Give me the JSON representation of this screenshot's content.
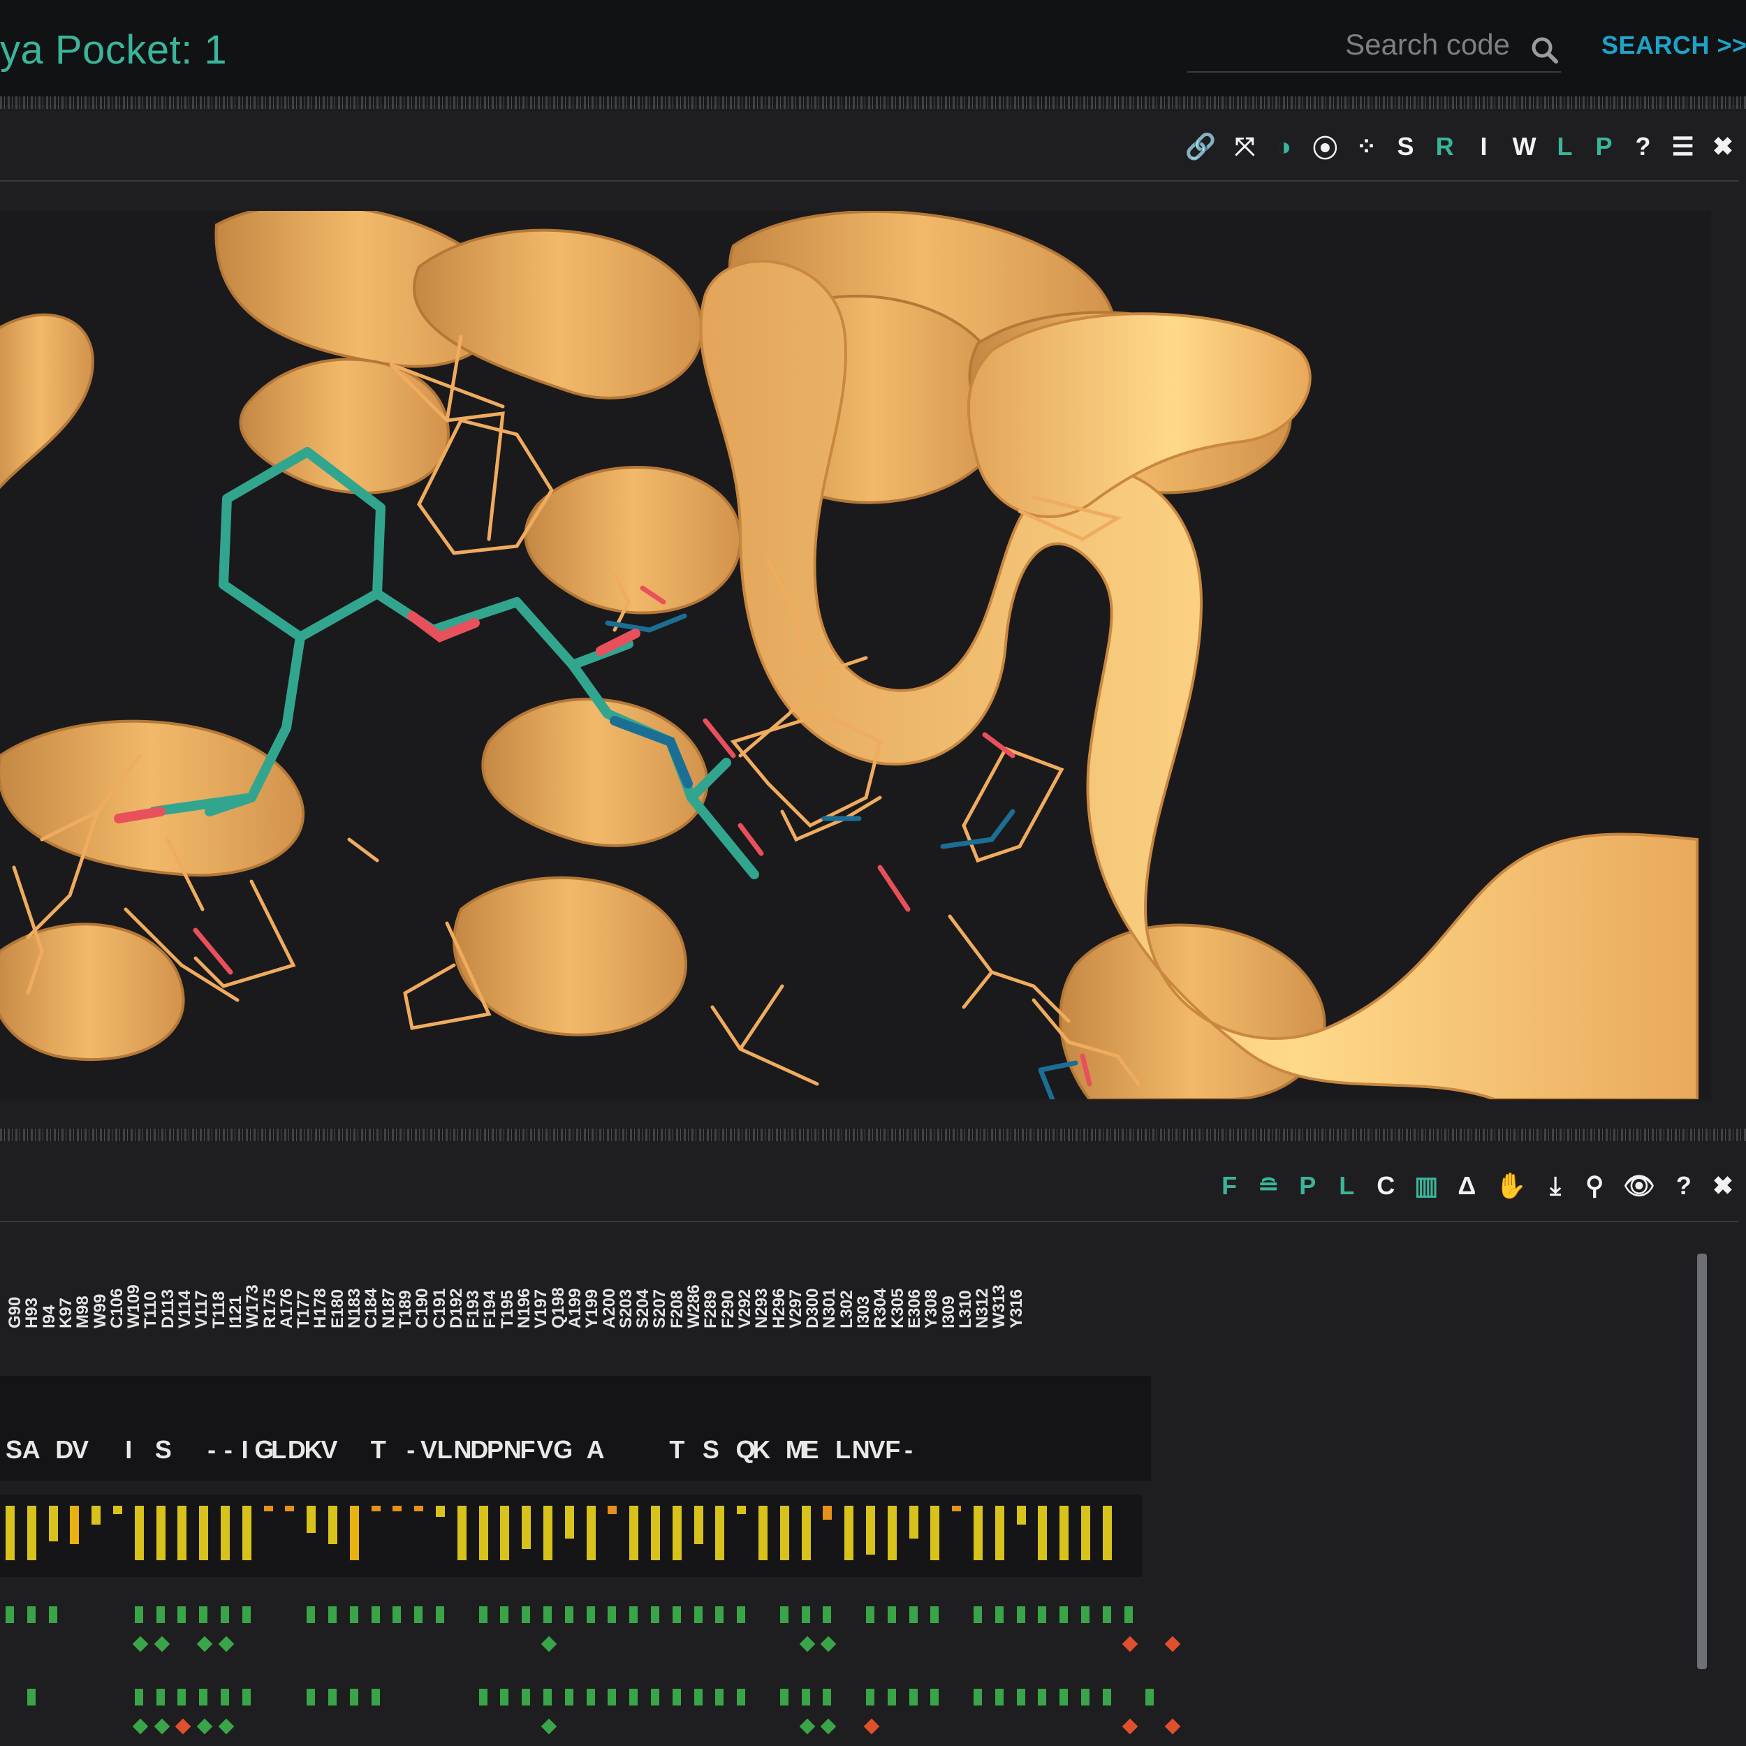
{
  "header": {
    "title": "ya Pocket: 1",
    "search_placeholder": "Search code",
    "search_link": "SEARCH >>"
  },
  "viewer_toolbar": [
    {
      "name": "link-icon",
      "glyph": "🔗",
      "color": "white"
    },
    {
      "name": "expand-icon",
      "glyph": "⤧",
      "color": "white"
    },
    {
      "name": "contrast-icon",
      "glyph": "◑",
      "color": "green"
    },
    {
      "name": "target-icon",
      "glyph": "⦿",
      "color": "white"
    },
    {
      "name": "spinner-icon",
      "glyph": "⁘",
      "color": "white"
    },
    {
      "name": "s-toggle",
      "glyph": "S",
      "color": "white"
    },
    {
      "name": "r-toggle",
      "glyph": "R",
      "color": "green"
    },
    {
      "name": "i-toggle",
      "glyph": "I",
      "color": "white"
    },
    {
      "name": "w-toggle",
      "glyph": "W",
      "color": "white"
    },
    {
      "name": "l-toggle",
      "glyph": "L",
      "color": "green"
    },
    {
      "name": "p-toggle",
      "glyph": "P",
      "color": "green"
    },
    {
      "name": "help-icon",
      "glyph": "?",
      "color": "white"
    },
    {
      "name": "menu-icon",
      "glyph": "☰",
      "color": "white"
    },
    {
      "name": "close-icon",
      "glyph": "✖",
      "color": "white"
    }
  ],
  "sequence_toolbar": [
    {
      "name": "f-toggle",
      "glyph": "F",
      "color": "green"
    },
    {
      "name": "stack-icon",
      "glyph": "≘",
      "color": "green"
    },
    {
      "name": "p-toggle",
      "glyph": "P",
      "color": "green"
    },
    {
      "name": "l-toggle",
      "glyph": "L",
      "color": "green"
    },
    {
      "name": "c-toggle",
      "glyph": "C",
      "color": "white"
    },
    {
      "name": "bar-chart-icon",
      "glyph": "▥",
      "color": "green"
    },
    {
      "name": "delta-icon",
      "glyph": "Δ",
      "color": "white"
    },
    {
      "name": "hand-icon",
      "glyph": "✋",
      "color": "white"
    },
    {
      "name": "download-icon",
      "glyph": "⤓",
      "color": "white"
    },
    {
      "name": "zoom-icon",
      "glyph": "⚲",
      "color": "white"
    },
    {
      "name": "eye-icon",
      "glyph": "👁",
      "color": "white"
    },
    {
      "name": "help-icon",
      "glyph": "?",
      "color": "white"
    },
    {
      "name": "close-icon",
      "glyph": "✖",
      "color": "white"
    }
  ],
  "residues": [
    "G90",
    "H93",
    "I94",
    "K97",
    "M98",
    "W99",
    "C106",
    "W109",
    "T110",
    "D113",
    "V114",
    "V117",
    "T118",
    "I121",
    "W173",
    "R175",
    "A176",
    "T177",
    "H178",
    "E180",
    "N183",
    "C184",
    "N187",
    "T189",
    "C190",
    "C191",
    "D192",
    "F193",
    "F194",
    "T195",
    "N196",
    "V197",
    "Q198",
    "A199",
    "Y199",
    "A200",
    "S203",
    "S204",
    "S207",
    "F208",
    "W286",
    "F289",
    "F290",
    "V292",
    "N293",
    "H296",
    "V297",
    "D300",
    "N301",
    "L302",
    "I303",
    "R304",
    "K305",
    "E306",
    "Y308",
    "I309",
    "L310",
    "N312",
    "W313",
    "Y316"
  ],
  "sequence": [
    "S",
    "A",
    "",
    "D",
    "V",
    "",
    "",
    "I",
    "",
    "S",
    "",
    "",
    "-",
    "-",
    "I",
    "G",
    "L",
    "D",
    "K",
    "V",
    "",
    "",
    "T",
    "",
    "-",
    "V",
    "L",
    "N",
    "D",
    "P",
    "N",
    "F",
    "V",
    "G",
    "",
    "A",
    "",
    "",
    "",
    "",
    "T",
    "",
    "S",
    "",
    "Q",
    "K",
    "",
    "M",
    "E",
    "",
    "L",
    "N",
    "V",
    "F",
    "-"
  ],
  "bar_colors": {
    "yellow": "#d8c21c",
    "amber": "#e8b210",
    "orange": "#e8901c"
  },
  "conservation": [
    [
      "yellow",
      1.0
    ],
    [
      "yellow",
      1.0
    ],
    [
      "yellow",
      0.65
    ],
    [
      "amber",
      0.7
    ],
    [
      "yellow",
      0.35
    ],
    [
      "yellow",
      0.15
    ],
    [
      "yellow",
      1.0
    ],
    [
      "yellow",
      1.0
    ],
    [
      "yellow",
      1.0
    ],
    [
      "yellow",
      1.0
    ],
    [
      "yellow",
      1.0
    ],
    [
      "yellow",
      1.0
    ],
    [
      "orange",
      0.1
    ],
    [
      "orange",
      0.1
    ],
    [
      "yellow",
      0.5
    ],
    [
      "yellow",
      0.7
    ],
    [
      "amber",
      1.0
    ],
    [
      "orange",
      0.1
    ],
    [
      "orange",
      0.1
    ],
    [
      "orange",
      0.1
    ],
    [
      "yellow",
      0.2
    ],
    [
      "yellow",
      1.0
    ],
    [
      "yellow",
      1.0
    ],
    [
      "yellow",
      1.0
    ],
    [
      "yellow",
      0.8
    ],
    [
      "yellow",
      1.0
    ],
    [
      "yellow",
      0.6
    ],
    [
      "yellow",
      1.0
    ],
    [
      "orange",
      0.15
    ],
    [
      "yellow",
      1.0
    ],
    [
      "yellow",
      1.0
    ],
    [
      "yellow",
      1.0
    ],
    [
      "yellow",
      0.7
    ],
    [
      "yellow",
      1.0
    ],
    [
      "yellow",
      0.15
    ],
    [
      "yellow",
      1.0
    ],
    [
      "yellow",
      1.0
    ],
    [
      "yellow",
      1.0
    ],
    [
      "orange",
      0.25
    ],
    [
      "yellow",
      1.0
    ],
    [
      "yellow",
      0.9
    ],
    [
      "yellow",
      1.0
    ],
    [
      "yellow",
      0.6
    ],
    [
      "yellow",
      1.0
    ],
    [
      "orange",
      0.1
    ],
    [
      "yellow",
      1.0
    ],
    [
      "yellow",
      1.0
    ],
    [
      "yellow",
      0.35
    ],
    [
      "yellow",
      1.0
    ],
    [
      "yellow",
      1.0
    ],
    [
      "yellow",
      1.0
    ],
    [
      "yellow",
      1.0
    ]
  ],
  "interaction_rows": [
    {
      "squares": [
        0,
        1,
        2,
        6,
        7,
        8,
        9,
        10,
        11,
        14,
        15,
        16,
        17,
        18,
        19,
        20,
        22,
        23,
        24,
        25,
        26,
        27,
        28,
        29,
        30,
        31,
        32,
        33,
        34,
        36,
        37,
        38,
        40,
        41,
        42,
        43,
        45,
        46,
        47,
        48,
        49,
        50,
        51,
        52
      ],
      "diamonds": [
        [
          6,
          "green"
        ],
        [
          7,
          "green"
        ],
        [
          9,
          "green"
        ],
        [
          10,
          "green"
        ],
        [
          25,
          "green"
        ],
        [
          37,
          "green"
        ],
        [
          38,
          "green"
        ],
        [
          52,
          "red"
        ],
        [
          54,
          "red"
        ]
      ]
    },
    {
      "squares": [
        1,
        6,
        7,
        8,
        9,
        10,
        11,
        14,
        15,
        16,
        17,
        22,
        23,
        24,
        25,
        26,
        27,
        28,
        29,
        30,
        31,
        32,
        33,
        34,
        36,
        37,
        38,
        40,
        41,
        42,
        43,
        45,
        46,
        47,
        48,
        49,
        50,
        51,
        53
      ],
      "diamonds": [
        [
          6,
          "green"
        ],
        [
          7,
          "green"
        ],
        [
          8,
          "red"
        ],
        [
          9,
          "green"
        ],
        [
          10,
          "green"
        ],
        [
          25,
          "green"
        ],
        [
          37,
          "green"
        ],
        [
          38,
          "green"
        ],
        [
          40,
          "red"
        ],
        [
          52,
          "red"
        ],
        [
          54,
          "red"
        ]
      ]
    }
  ],
  "colors": {
    "accent": "#3bb59a",
    "link": "#1fa2c8",
    "protein": "#f5b565",
    "ligand": "#32a58e",
    "oxygen": "#e8505b",
    "nitrogen": "#1b6f95"
  }
}
